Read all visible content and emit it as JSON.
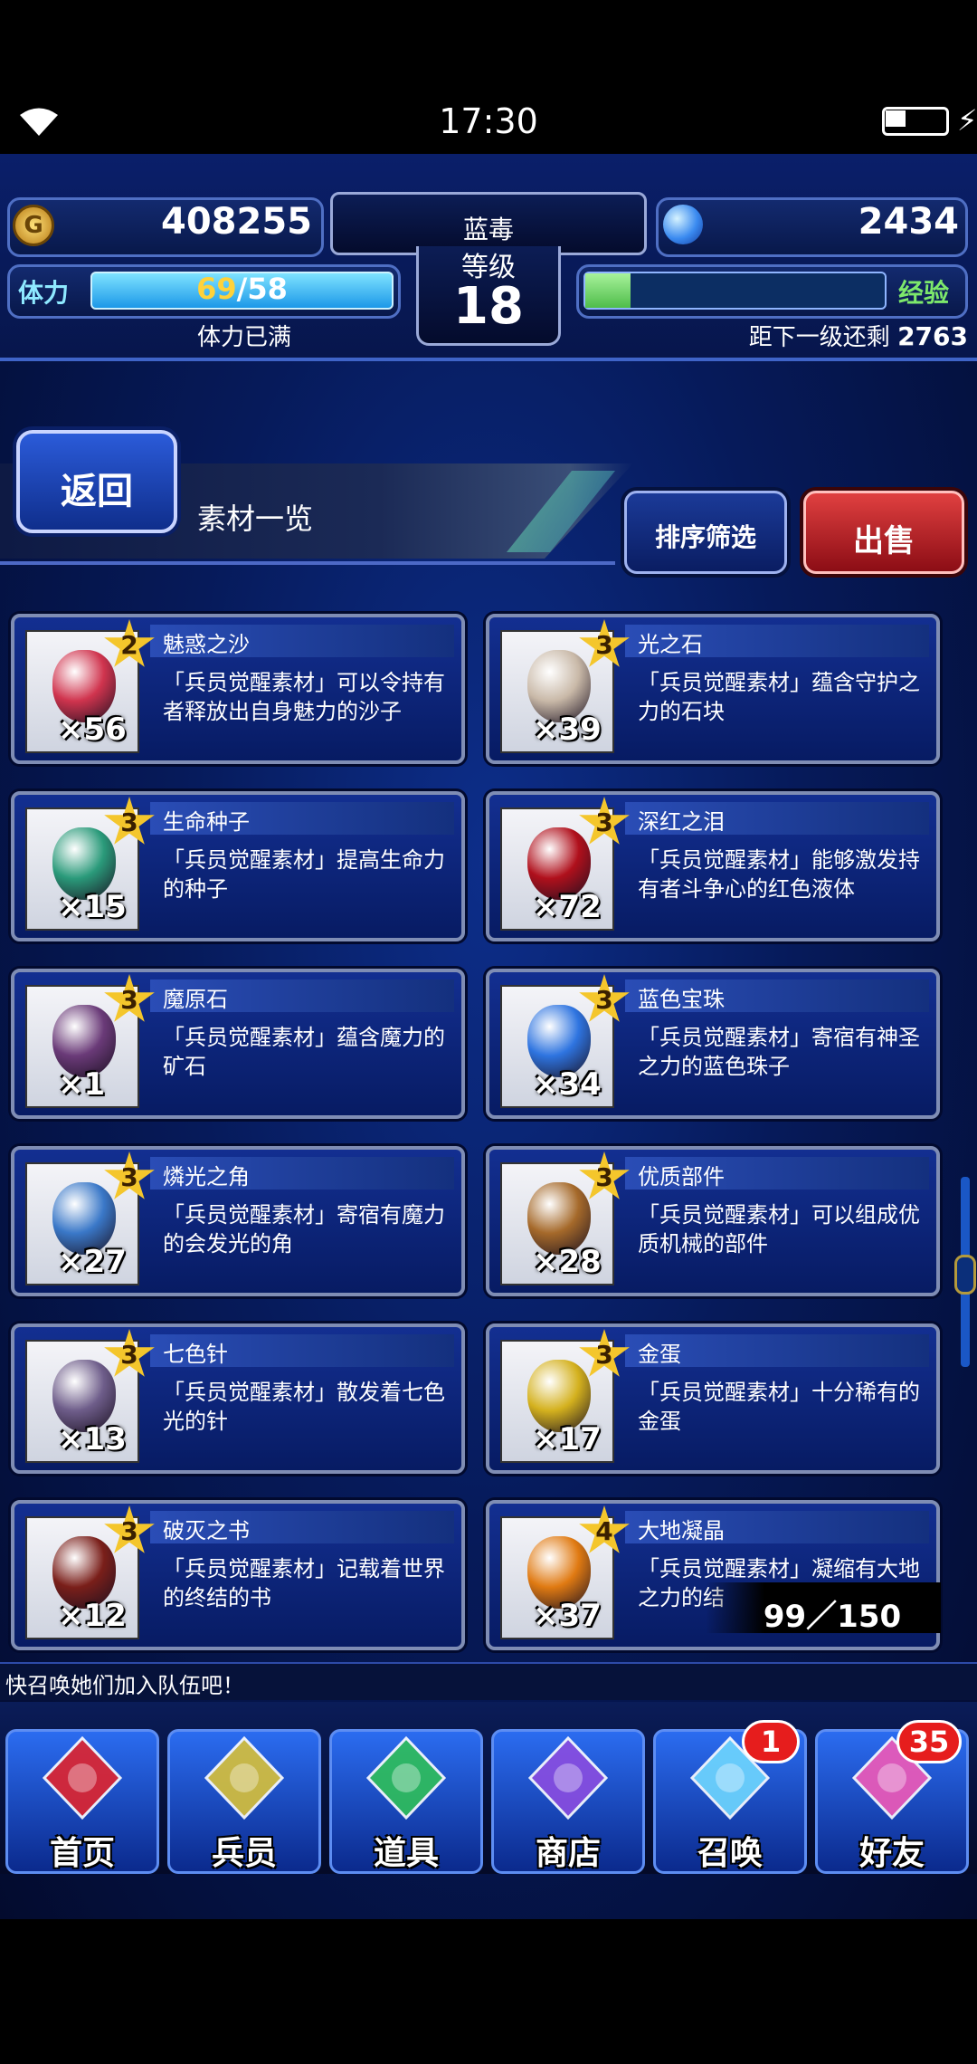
{
  "status_bar": {
    "time": "17:30"
  },
  "hud": {
    "gil": "408255",
    "gems": "2434",
    "player_name": "蓝毒",
    "level_label": "等级",
    "level": "18",
    "stamina_label": "体力",
    "stamina_current": "69",
    "stamina_sep_max": "/58",
    "stamina_status": "体力已满",
    "exp_label": "经验",
    "exp_fill_fraction": 0.15,
    "next_level_label": "距下一级还剩",
    "next_level_value": "2763"
  },
  "titlebar": {
    "back_label": "返回",
    "page_title": "素材一览",
    "sort_label": "排序筛选",
    "sell_label": "出售"
  },
  "items": [
    {
      "name": "魅惑之沙",
      "rarity": "2",
      "qty": "×56",
      "desc1": "「兵员觉醒素材」可以令持有",
      "desc2": "者释放出自身魅力的沙子",
      "color": "#d0344e"
    },
    {
      "name": "光之石",
      "rarity": "3",
      "qty": "×39",
      "desc1": "「兵员觉醒素材」蕴含守护之",
      "desc2": "力的石块",
      "color": "#c9b9a8"
    },
    {
      "name": "生命种子",
      "rarity": "3",
      "qty": "×15",
      "desc1": "「兵员觉醒素材」提高生命力",
      "desc2": "的种子",
      "color": "#2a9a7a"
    },
    {
      "name": "深红之泪",
      "rarity": "3",
      "qty": "×72",
      "desc1": "「兵员觉醒素材」能够激发持",
      "desc2": "有者斗争心的红色液体",
      "color": "#b0101c"
    },
    {
      "name": "魔原石",
      "rarity": "3",
      "qty": "×1",
      "desc1": "「兵员觉醒素材」蕴含魔力的",
      "desc2": "矿石",
      "color": "#6a3a78"
    },
    {
      "name": "蓝色宝珠",
      "rarity": "3",
      "qty": "×34",
      "desc1": "「兵员觉醒素材」寄宿有神圣",
      "desc2": "之力的蓝色珠子",
      "color": "#2e74e0"
    },
    {
      "name": "燐光之角",
      "rarity": "3",
      "qty": "×27",
      "desc1": "「兵员觉醒素材」寄宿有魔力",
      "desc2": "的会发光的角",
      "color": "#3a78c8"
    },
    {
      "name": "优质部件",
      "rarity": "3",
      "qty": "×28",
      "desc1": "「兵员觉醒素材」可以组成优",
      "desc2": "质机械的部件",
      "color": "#a5692a"
    },
    {
      "name": "七色针",
      "rarity": "3",
      "qty": "×13",
      "desc1": "「兵员觉醒素材」散发着七色",
      "desc2": "光的针",
      "color": "#6e5d8a"
    },
    {
      "name": "金蛋",
      "rarity": "3",
      "qty": "×17",
      "desc1": "「兵员觉醒素材」十分稀有的",
      "desc2": "金蛋",
      "color": "#d4b11e"
    },
    {
      "name": "破灭之书",
      "rarity": "3",
      "qty": "×12",
      "desc1": "「兵员觉醒素材」记载着世界",
      "desc2": "的终结的书",
      "color": "#7a1f1a"
    },
    {
      "name": "大地凝晶",
      "rarity": "4",
      "qty": "×37",
      "desc1": "「兵员觉醒素材」凝缩有大地",
      "desc2": "之力的结",
      "color": "#e07a12"
    }
  ],
  "page_counter": "99／150",
  "ticker": "快召唤她们加入队伍吧！",
  "nav": [
    {
      "label": "首页",
      "icon": "sword-icon",
      "color": "#e0242e"
    },
    {
      "label": "兵员",
      "icon": "hero-icon",
      "color": "#d8c13a"
    },
    {
      "label": "道具",
      "icon": "potion-icon",
      "color": "#2fbf5a"
    },
    {
      "label": "商店",
      "icon": "shop-icon",
      "color": "#8a4de0"
    },
    {
      "label": "召唤",
      "icon": "crystal-icon",
      "color": "#6fd7ff",
      "badge": "1"
    },
    {
      "label": "好友",
      "icon": "friends-icon",
      "color": "#f05ab8",
      "badge": "35"
    }
  ]
}
